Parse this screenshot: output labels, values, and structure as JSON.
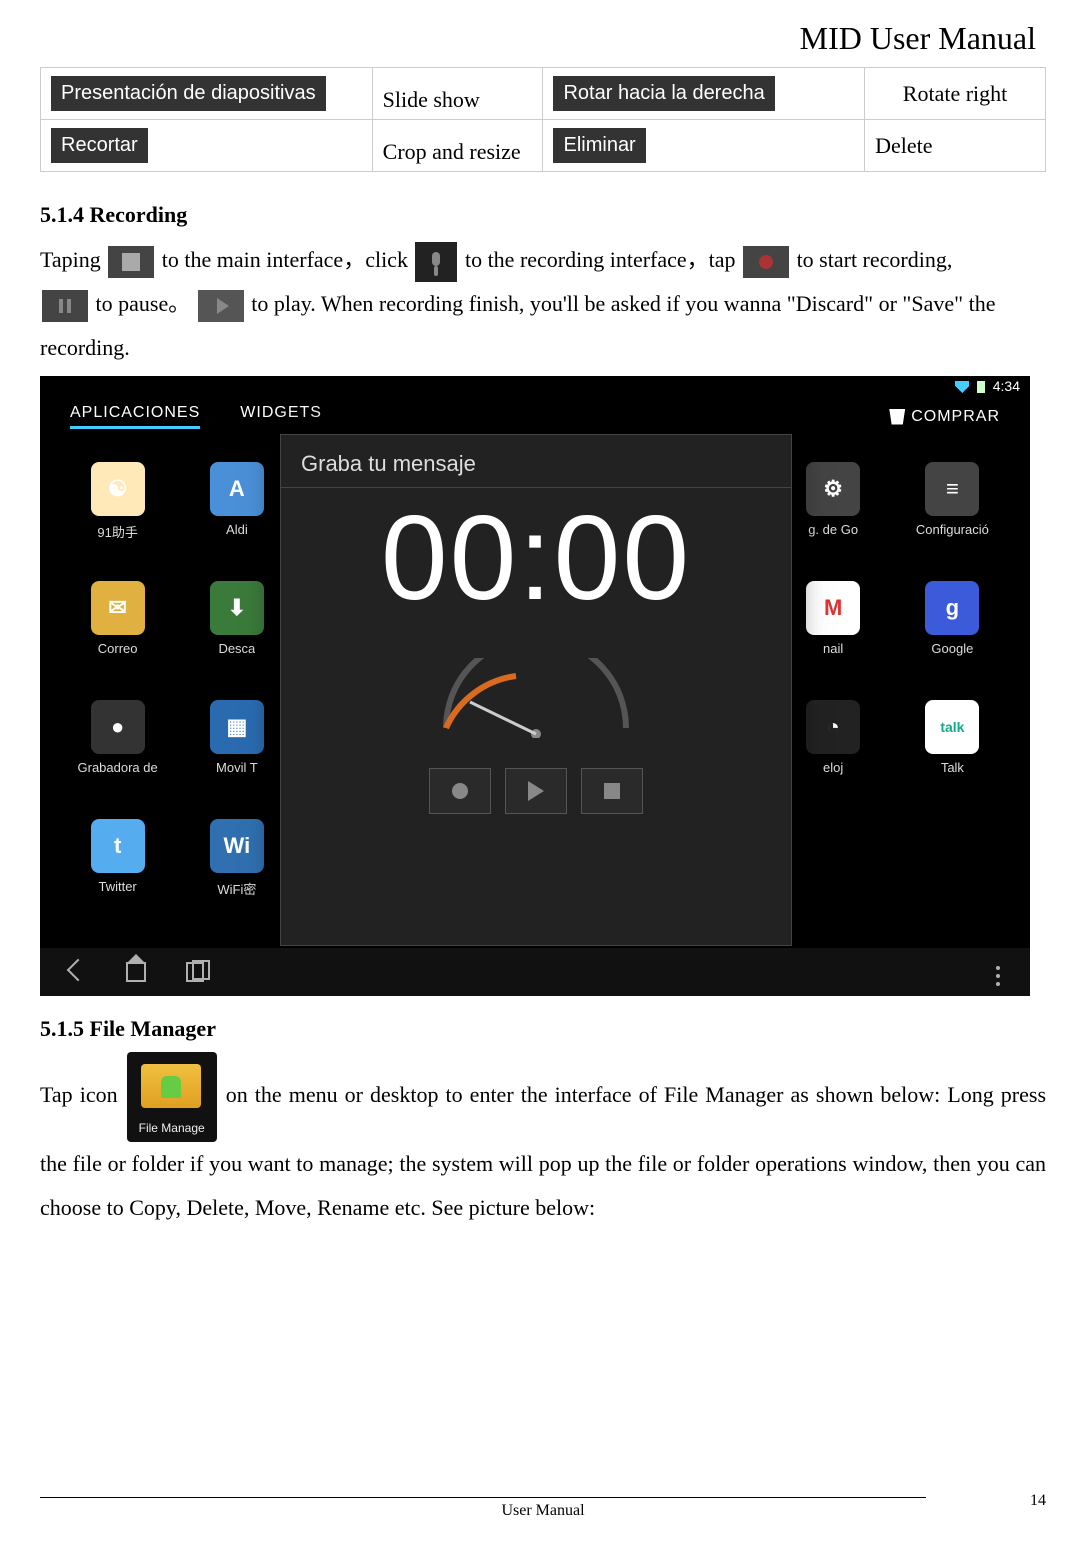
{
  "header": {
    "title": "MID User Manual"
  },
  "top_table": {
    "rows": [
      {
        "btn": "Presentación de diapositivas",
        "label": "Slide show",
        "btn2": "Rotar hacia la derecha",
        "label2": "Rotate right"
      },
      {
        "btn": "Recortar",
        "label": "Crop and resize",
        "btn2": "Eliminar",
        "label2": "Delete"
      }
    ]
  },
  "section_514": {
    "heading": "5.1.4 Recording",
    "t1": "Taping",
    "t2": "to the main interface，click ",
    "t3": "to the recording interface，tap",
    "t4": "to start recording,",
    "t5": "to pause。",
    "t6": " to play. When recording finish, you'll be asked if you wanna \"Discard\" or \"Save\" the recording."
  },
  "screenshot": {
    "status_time": "4:34",
    "tab_apps": "APLICACIONES",
    "tab_widgets": "WIDGETS",
    "shop": "COMPRAR",
    "overlay": {
      "title": "Graba tu mensaje",
      "timer": "00:00"
    },
    "apps": [
      {
        "label": "91助手",
        "bg": "#ffe9b8",
        "glyph": "☯"
      },
      {
        "label": "Aldi",
        "bg": "#4a90d9",
        "glyph": "A"
      },
      {
        "label": "",
        "bg": "#000000",
        "glyph": ""
      },
      {
        "label": "",
        "bg": "#000000",
        "glyph": ""
      },
      {
        "label": "",
        "bg": "#000000",
        "glyph": ""
      },
      {
        "label": "",
        "bg": "#000000",
        "glyph": ""
      },
      {
        "label": "g. de Go",
        "bg": "#444444",
        "glyph": "⚙"
      },
      {
        "label": "Configuració",
        "bg": "#444444",
        "glyph": "≡"
      },
      {
        "label": "Correo",
        "bg": "#e0b040",
        "glyph": "✉"
      },
      {
        "label": "Desca",
        "bg": "#3a7a3a",
        "glyph": "⬇"
      },
      {
        "label": "",
        "bg": "#000000",
        "glyph": ""
      },
      {
        "label": "",
        "bg": "#000000",
        "glyph": ""
      },
      {
        "label": "",
        "bg": "#000000",
        "glyph": ""
      },
      {
        "label": "",
        "bg": "#000000",
        "glyph": ""
      },
      {
        "label": "nail",
        "bg": "#ffffff",
        "glyph": "M"
      },
      {
        "label": "Google",
        "bg": "#3b5bdb",
        "glyph": "g"
      },
      {
        "label": "Grabadora de",
        "bg": "#333333",
        "glyph": "●"
      },
      {
        "label": "Movil T",
        "bg": "#2a6bb0",
        "glyph": "▦"
      },
      {
        "label": "",
        "bg": "#000000",
        "glyph": ""
      },
      {
        "label": "",
        "bg": "#000000",
        "glyph": ""
      },
      {
        "label": "",
        "bg": "#000000",
        "glyph": ""
      },
      {
        "label": "",
        "bg": "#000000",
        "glyph": ""
      },
      {
        "label": "eloj",
        "bg": "#222222",
        "glyph": "◔"
      },
      {
        "label": "Talk",
        "bg": "#ffffff",
        "glyph": "talk"
      },
      {
        "label": "Twitter",
        "bg": "#55acee",
        "glyph": "t"
      },
      {
        "label": "WiFi密",
        "bg": "#3070b0",
        "glyph": "Wi"
      },
      {
        "label": "",
        "bg": "#000000",
        "glyph": ""
      },
      {
        "label": "",
        "bg": "#000000",
        "glyph": ""
      },
      {
        "label": "",
        "bg": "#000000",
        "glyph": ""
      },
      {
        "label": "",
        "bg": "#000000",
        "glyph": ""
      },
      {
        "label": "",
        "bg": "#000000",
        "glyph": ""
      },
      {
        "label": "",
        "bg": "#000000",
        "glyph": ""
      }
    ]
  },
  "section_515": {
    "heading": "5.1.5 File Manager",
    "fm_label": "File Manage",
    "t1": "Tap icon",
    "t2": " on the menu or desktop to enter the interface of File Manager as shown below: Long press the file or folder if you want to  manage; the system will pop up the file or folder operations window, then you can choose to Copy, Delete, Move, Rename etc. See picture below:"
  },
  "footer": {
    "center": "User Manual",
    "page": "14"
  }
}
